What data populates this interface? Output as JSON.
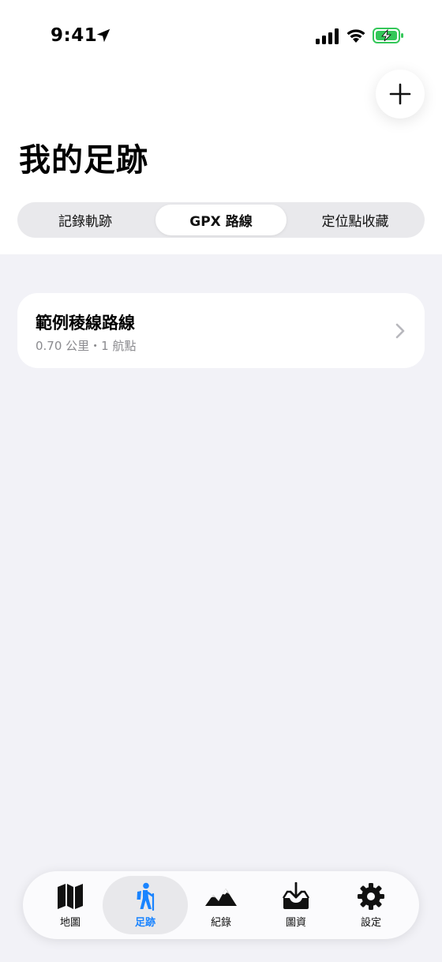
{
  "status": {
    "time": "9:41",
    "icons": [
      "location-arrow-icon",
      "cellular-signal-icon",
      "wifi-icon",
      "battery-charging-icon"
    ],
    "battery_color": "#34c759"
  },
  "header": {
    "title": "我的足跡",
    "add_icon": "plus-icon"
  },
  "segments": [
    {
      "label": "記錄軌跡",
      "selected": false
    },
    {
      "label": "GPX 路線",
      "selected": true
    },
    {
      "label": "定位點收藏",
      "selected": false
    }
  ],
  "routes": [
    {
      "name": "範例稜線路線",
      "meta": "0.70 公里・1 航點"
    }
  ],
  "tabbar": {
    "accent": "#1a84ff",
    "tabs": [
      {
        "label": "地圖",
        "icon": "map-icon",
        "active": false
      },
      {
        "label": "足跡",
        "icon": "hiker-icon",
        "active": true
      },
      {
        "label": "紀錄",
        "icon": "mountains-icon",
        "active": false
      },
      {
        "label": "圖資",
        "icon": "tray-download-icon",
        "active": false
      },
      {
        "label": "設定",
        "icon": "gear-icon",
        "active": false
      }
    ]
  }
}
